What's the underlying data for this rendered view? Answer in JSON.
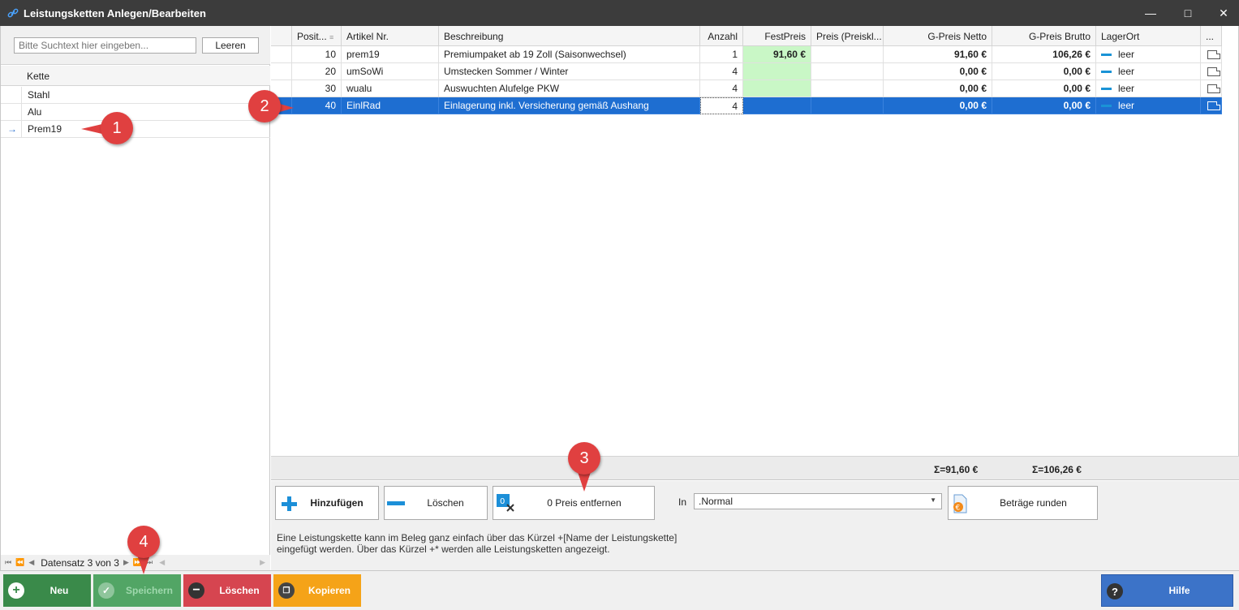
{
  "window": {
    "title": "Leistungsketten Anlegen/Bearbeiten",
    "minimize": "—",
    "maximize": "□",
    "close": "✕"
  },
  "left_panel": {
    "search_placeholder": "Bitte Suchtext hier eingeben...",
    "clear_label": "Leeren",
    "column_header": "Kette",
    "items": [
      "Stahl",
      "Alu",
      "Prem19"
    ],
    "current_indicator": "→",
    "record_nav": "Datensatz 3 von 3"
  },
  "grid": {
    "headers": [
      "Posit...",
      "Artikel Nr.",
      "Beschreibung",
      "Anzahl",
      "FestPreis",
      "Preis (Preiskl...",
      "G-Preis Netto",
      "G-Preis Brutto",
      "LagerOrt",
      "..."
    ],
    "rows": [
      {
        "pos": "10",
        "artikel": "prem19",
        "beschreibung": "Premiumpaket ab 19 Zoll (Saisonwechsel)",
        "anzahl": "1",
        "festpreis": "91,60 €",
        "preis": "",
        "netto": "91,60 €",
        "brutto": "106,26 €",
        "lager": "leer"
      },
      {
        "pos": "20",
        "artikel": "umSoWi",
        "beschreibung": "Umstecken Sommer / Winter",
        "anzahl": "4",
        "festpreis": "",
        "preis": "",
        "netto": "0,00 €",
        "brutto": "0,00 €",
        "lager": "leer"
      },
      {
        "pos": "30",
        "artikel": "wualu",
        "beschreibung": "Auswuchten Alufelge PKW",
        "anzahl": "4",
        "festpreis": "",
        "preis": "",
        "netto": "0,00 €",
        "brutto": "0,00 €",
        "lager": "leer"
      },
      {
        "pos": "40",
        "artikel": "EinlRad",
        "beschreibung": "Einlagerung inkl. Versicherung gemäß Aushang",
        "anzahl": "4",
        "festpreis": "",
        "preis": "",
        "netto": "0,00 €",
        "brutto": "0,00 €",
        "lager": "leer"
      }
    ],
    "sum_netto": "Σ=91,60 €",
    "sum_brutto": "Σ=106,26 €"
  },
  "tools": {
    "add_label": "Hinzufügen",
    "delete_label": "Löschen",
    "remove_price_label": "0 Preis entfernen",
    "in_label": "In",
    "price_group_value": ".Normal",
    "round_label": "Beträge runden",
    "info_line1": "Eine Leistungskette kann im Beleg ganz einfach über das Kürzel +[Name der Leistungskette]",
    "info_line2": "eingefügt werden. Über das Kürzel +*  werden alle Leistungsketten angezeigt."
  },
  "bottom": {
    "neu": "Neu",
    "speichern": "Speichern",
    "loeschen": "Löschen",
    "kopieren": "Kopieren",
    "hilfe": "Hilfe"
  },
  "markers": [
    "1",
    "2",
    "3",
    "4"
  ],
  "colors": {
    "selection": "#1e6ed1",
    "festpreis_green": "#c9f7c6",
    "btn_neu": "#3a8a4a",
    "btn_speichern": "#52a565",
    "btn_loeschen": "#d64550",
    "btn_kopieren": "#f5a318",
    "btn_hilfe": "#3c73c8",
    "marker": "#e04040"
  }
}
